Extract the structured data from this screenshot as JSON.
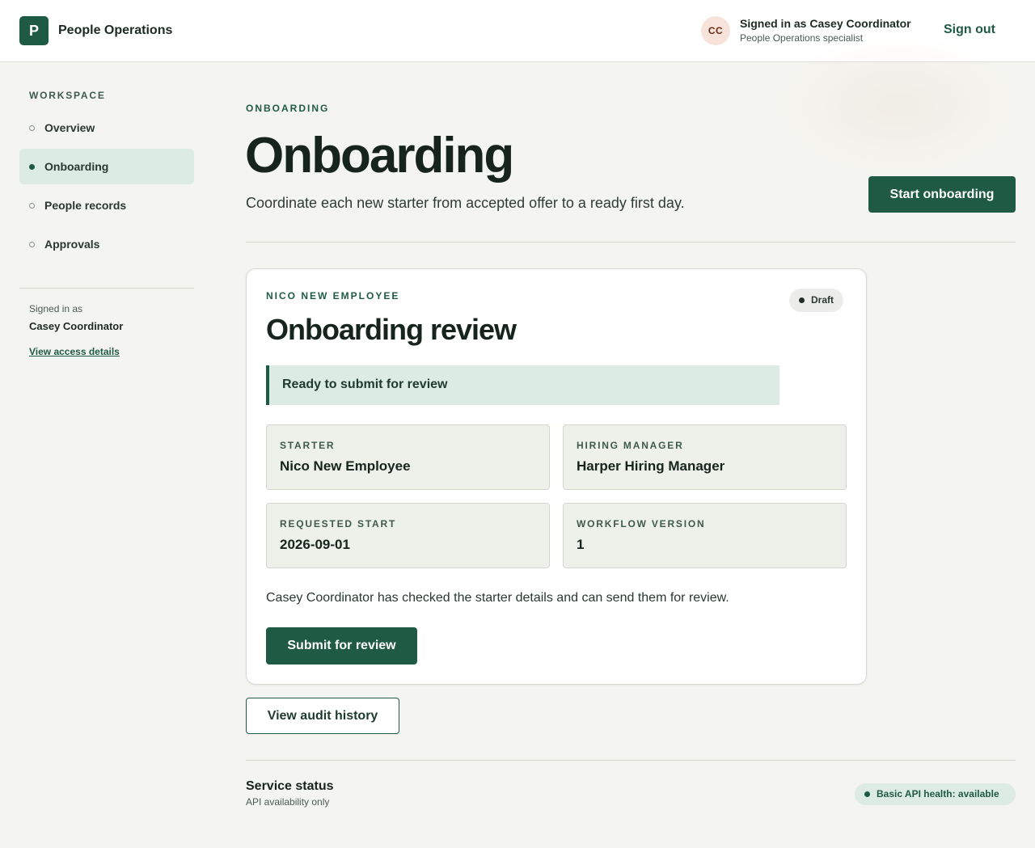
{
  "header": {
    "logo_letter": "P",
    "app_title": "People Operations",
    "avatar_initials": "CC",
    "signed_in_line": "Signed in as Casey Coordinator",
    "user_role": "People Operations specialist",
    "sign_out_label": "Sign out"
  },
  "sidebar": {
    "heading": "WORKSPACE",
    "items": [
      {
        "label": "Overview",
        "active": false
      },
      {
        "label": "Onboarding",
        "active": true
      },
      {
        "label": "People records",
        "active": false
      },
      {
        "label": "Approvals",
        "active": false
      }
    ],
    "signed_in_label": "Signed in as",
    "signed_in_name": "Casey Coordinator",
    "access_link": "View access details"
  },
  "main": {
    "eyebrow": "ONBOARDING",
    "title": "Onboarding",
    "subtitle": "Coordinate each new starter from accepted offer to a ready first day.",
    "start_button": "Start onboarding"
  },
  "card": {
    "eyebrow": "NICO NEW EMPLOYEE",
    "status_badge": "Draft",
    "title": "Onboarding review",
    "banner": "Ready to submit for review",
    "fields": [
      {
        "label": "STARTER",
        "value": "Nico New Employee"
      },
      {
        "label": "HIRING MANAGER",
        "value": "Harper Hiring Manager"
      },
      {
        "label": "REQUESTED START",
        "value": "2026-09-01"
      },
      {
        "label": "WORKFLOW VERSION",
        "value": "1"
      }
    ],
    "note": "Casey Coordinator has checked the starter details and can send them for review.",
    "submit_button": "Submit for review"
  },
  "audit_button": "View audit history",
  "footer": {
    "title": "Service status",
    "subtitle": "API availability only",
    "health": "Basic API health: available"
  },
  "colors": {
    "brand": "#1f5a44",
    "active_nav": "#dcebe3",
    "page_bg": "#f4f4f0"
  }
}
